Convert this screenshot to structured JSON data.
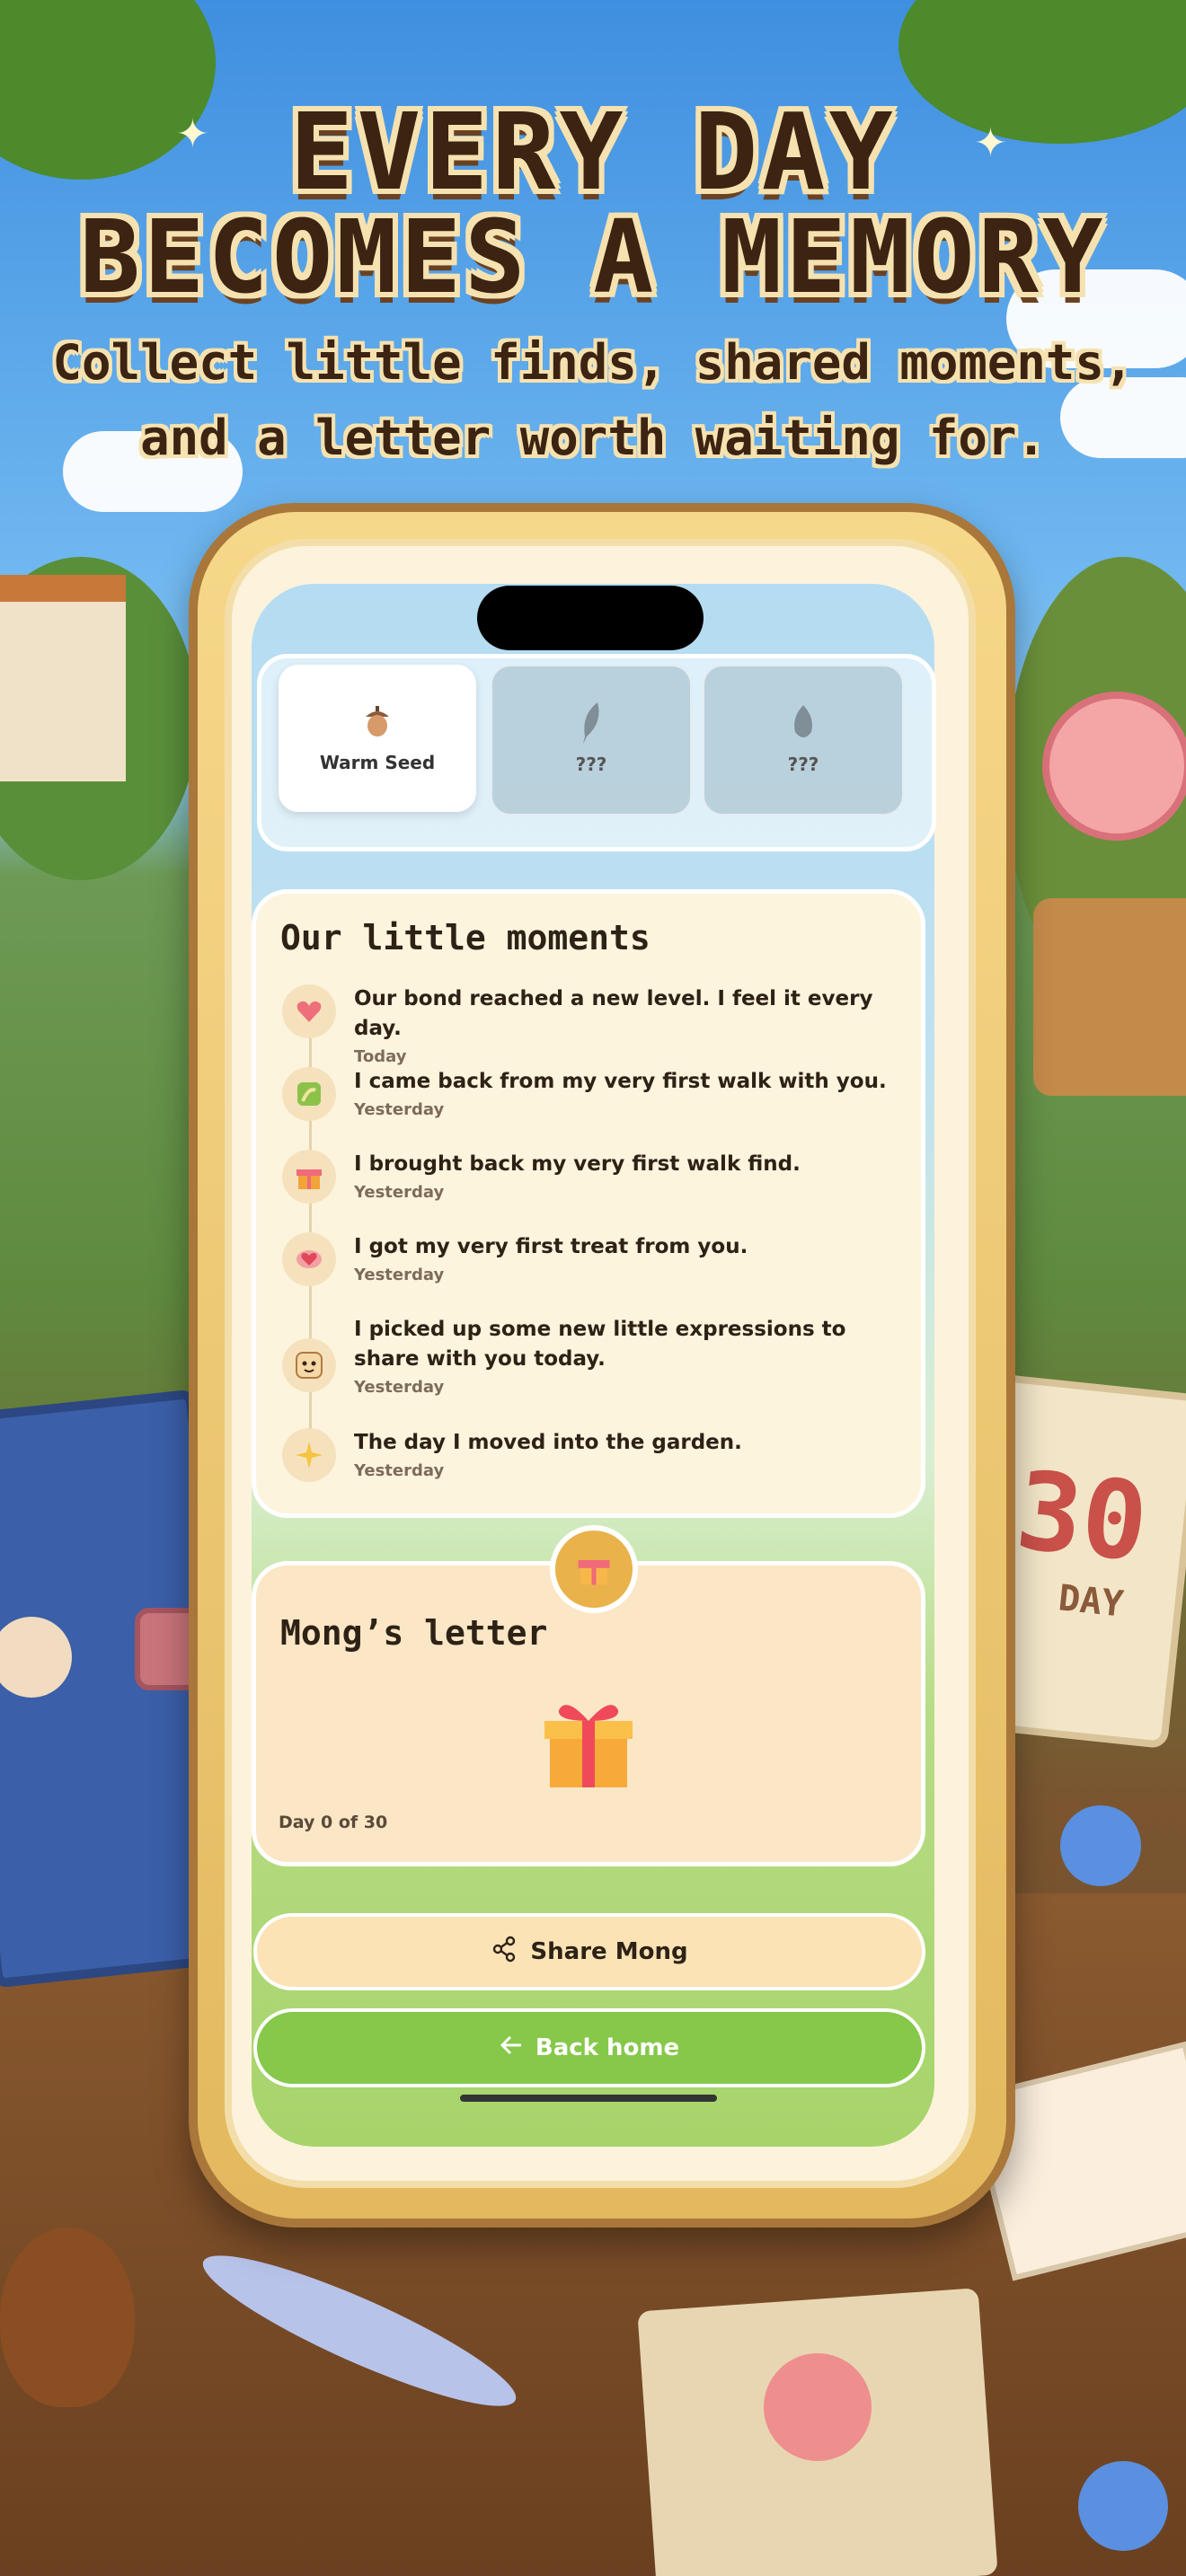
{
  "headline": {
    "line1": "EVERY DAY",
    "line2": "BECOMES A MEMORY",
    "sub1": "Collect little finds, shared moments,",
    "sub2": "and a letter worth waiting for."
  },
  "finds": [
    {
      "label": "Warm Seed",
      "icon": "acorn-icon",
      "locked": false
    },
    {
      "label": "???",
      "icon": "feather-silhouette-icon",
      "locked": true
    },
    {
      "label": "???",
      "icon": "seed-silhouette-icon",
      "locked": true
    }
  ],
  "moments": {
    "title": "Our little moments",
    "items": [
      {
        "icon": "heart-icon",
        "text": "Our bond reached a new level. I feel it every day.",
        "time": "Today"
      },
      {
        "icon": "walk-map-icon",
        "text": "I came back from my very first walk with you.",
        "time": "Yesterday"
      },
      {
        "icon": "gift-icon",
        "text": "I brought back my very first walk find.",
        "time": "Yesterday"
      },
      {
        "icon": "treat-icon",
        "text": "I got my very first treat from you.",
        "time": "Yesterday"
      },
      {
        "icon": "expression-face-icon",
        "text": "I picked up some new little expressions to share with you today.",
        "time": "Yesterday"
      },
      {
        "icon": "sparkle-icon",
        "text": "The day I moved into the garden.",
        "time": "Yesterday"
      }
    ]
  },
  "letter": {
    "title": "Mong’s letter",
    "progress": "Day 0 of 30",
    "progress_value": 0,
    "progress_total": 30
  },
  "buttons": {
    "share": "Share Mong",
    "back": "Back home"
  },
  "decor": {
    "calendar_number": "30",
    "calendar_label": "DAY"
  },
  "colors": {
    "accent_green": "#86c84a",
    "card_cream": "#fdf4de",
    "share_bg": "#fbe3b6",
    "text_dark": "#2d2215"
  }
}
